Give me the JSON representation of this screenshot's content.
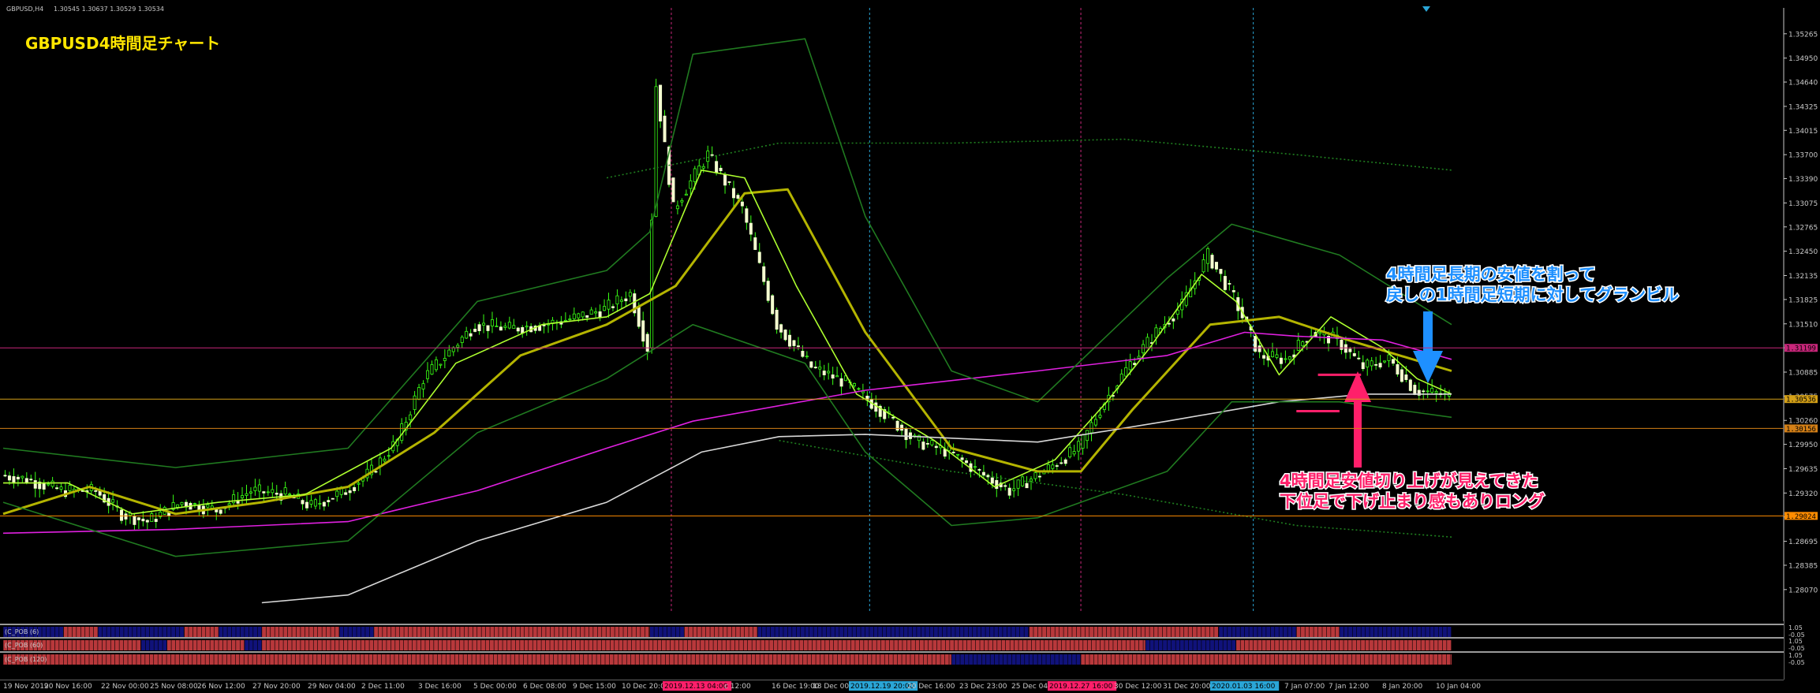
{
  "window": {
    "symbol": "GBPUSD,H4",
    "ohlc": "1.30545 1.30637 1.30529 1.30534",
    "title": "GBPUSD4時間足チャート"
  },
  "annotations": {
    "blue_line1": "4時間足長期の安値を割って",
    "blue_line2": "戻しの1時間足短期に対してグランビル",
    "pink_line1": "4時間足安値切り上げが見えてきた",
    "pink_line2": "下位足で下げ止まり感もありロング"
  },
  "levels": [
    {
      "value": 1.31199,
      "label": "1.31199",
      "color": "#c8267a"
    },
    {
      "value": 1.30536,
      "label": "1.30536",
      "color": "#d4a017"
    },
    {
      "value": 1.30156,
      "label": "1.30156",
      "color": "#d48017"
    },
    {
      "value": 1.29024,
      "label": "1.29024",
      "color": "#ff8c00"
    }
  ],
  "indicators": [
    {
      "name": "(C_POB (6)",
      "scale_top": "1.05",
      "scale_bot": "-0.05"
    },
    {
      "name": "(C_POB (60)",
      "scale_top": "1.05",
      "scale_bot": "-0.05"
    },
    {
      "name": "(C_POB (120)",
      "scale_top": "1.05",
      "scale_bot": "-0.05"
    }
  ],
  "chart_data": {
    "type": "candlestick",
    "title": "GBPUSD4時間足チャート",
    "symbol": "GBPUSD,H4",
    "ylim": [
      1.27762,
      1.356
    ],
    "y_ticks": [
      1.35265,
      1.3495,
      1.3464,
      1.34325,
      1.34015,
      1.337,
      1.3339,
      1.33075,
      1.32765,
      1.3245,
      1.32135,
      1.31825,
      1.3151,
      1.312,
      1.30885,
      1.30575,
      1.3026,
      1.2995,
      1.29635,
      1.2932,
      1.2901,
      1.28695,
      1.28385,
      1.2807
    ],
    "x_ticks": [
      "19 Nov 2019",
      "20 Nov 16:00",
      "22 Nov 00:00",
      "25 Nov 08:00",
      "26 Nov 12:00",
      "27 Nov 20:00",
      "29 Nov 04:00",
      "2 Dec 11:00",
      "3 Dec 16:00",
      "5 Dec 00:00",
      "6 Dec 08:00",
      "9 Dec 15:00",
      "10 Dec 20:00",
      "2019.12.13 04:00",
      "c 12:00",
      "16 Dec 19:00",
      "18 Dec 00:00",
      "2019.12.19 20:00",
      "20 Dec 16:00",
      "23 Dec 23:00",
      "25 Dec 04:00",
      "2019.12.27 16:00",
      "30 Dec 12:00",
      "31 Dec 20:00",
      "2020.01.03 16:00",
      "7 Jan 07:00",
      "7 Jan 12:00",
      "8 Jan 20:00",
      "10 Jan 04:00"
    ],
    "x_highlighted": [
      "2019.12.13 04:00",
      "2019.12.19 20:00",
      "2019.12.27 16:00",
      "2020.01.03 16:00"
    ],
    "anchors": [
      [
        0,
        1.2955
      ],
      [
        6,
        1.295
      ],
      [
        14,
        1.2935
      ],
      [
        22,
        1.2935
      ],
      [
        28,
        1.2905
      ],
      [
        34,
        1.2895
      ],
      [
        42,
        1.292
      ],
      [
        50,
        1.291
      ],
      [
        58,
        1.2935
      ],
      [
        66,
        1.293
      ],
      [
        72,
        1.2915
      ],
      [
        80,
        1.2935
      ],
      [
        86,
        1.296
      ],
      [
        92,
        1.3
      ],
      [
        98,
        1.308
      ],
      [
        104,
        1.3115
      ],
      [
        110,
        1.315
      ],
      [
        118,
        1.3145
      ],
      [
        126,
        1.315
      ],
      [
        134,
        1.316
      ],
      [
        140,
        1.317
      ],
      [
        146,
        1.319
      ],
      [
        150,
        1.312
      ],
      [
        152,
        1.346
      ],
      [
        156,
        1.33
      ],
      [
        164,
        1.337
      ],
      [
        172,
        1.33
      ],
      [
        180,
        1.315
      ],
      [
        188,
        1.3095
      ],
      [
        196,
        1.3075
      ],
      [
        204,
        1.304
      ],
      [
        212,
        1.3
      ],
      [
        220,
        1.2985
      ],
      [
        228,
        1.2955
      ],
      [
        234,
        1.2935
      ],
      [
        242,
        1.296
      ],
      [
        250,
        1.299
      ],
      [
        256,
        1.305
      ],
      [
        262,
        1.31
      ],
      [
        268,
        1.314
      ],
      [
        274,
        1.3175
      ],
      [
        280,
        1.324
      ],
      [
        286,
        1.3185
      ],
      [
        292,
        1.311
      ],
      [
        298,
        1.3105
      ],
      [
        304,
        1.314
      ],
      [
        310,
        1.313
      ],
      [
        316,
        1.3095
      ],
      [
        322,
        1.3105
      ],
      [
        328,
        1.3065
      ],
      [
        334,
        1.306
      ],
      [
        336,
        1.3055
      ]
    ],
    "series": [
      {
        "name": "",
        "type": "line",
        "color": "#b4b400",
        "points": [
          [
            0,
            1.2905
          ],
          [
            20,
            1.294
          ],
          [
            40,
            1.2905
          ],
          [
            60,
            1.292
          ],
          [
            80,
            1.294
          ],
          [
            100,
            1.301
          ],
          [
            120,
            1.311
          ],
          [
            140,
            1.315
          ],
          [
            156,
            1.32
          ],
          [
            172,
            1.332
          ],
          [
            182,
            1.3325
          ],
          [
            200,
            1.314
          ],
          [
            220,
            1.299
          ],
          [
            240,
            1.296
          ],
          [
            250,
            1.296
          ],
          [
            262,
            1.304
          ],
          [
            280,
            1.315
          ],
          [
            296,
            1.316
          ],
          [
            312,
            1.313
          ],
          [
            336,
            1.309
          ]
        ]
      },
      {
        "name": "",
        "type": "line",
        "color": "#adff2f",
        "points": [
          [
            0,
            1.2945
          ],
          [
            15,
            1.2945
          ],
          [
            30,
            1.2905
          ],
          [
            50,
            1.292
          ],
          [
            70,
            1.293
          ],
          [
            90,
            1.299
          ],
          [
            105,
            1.31
          ],
          [
            125,
            1.315
          ],
          [
            140,
            1.316
          ],
          [
            150,
            1.319
          ],
          [
            162,
            1.335
          ],
          [
            172,
            1.334
          ],
          [
            184,
            1.32
          ],
          [
            198,
            1.306
          ],
          [
            216,
            1.3
          ],
          [
            230,
            1.294
          ],
          [
            244,
            1.2975
          ],
          [
            256,
            1.305
          ],
          [
            266,
            1.312
          ],
          [
            278,
            1.3215
          ],
          [
            286,
            1.318
          ],
          [
            296,
            1.3085
          ],
          [
            308,
            1.316
          ],
          [
            320,
            1.312
          ],
          [
            328,
            1.308
          ],
          [
            336,
            1.306
          ]
        ]
      },
      {
        "name": "",
        "type": "line",
        "color": "#e020e0",
        "points": [
          [
            0,
            1.288
          ],
          [
            40,
            1.2885
          ],
          [
            80,
            1.2895
          ],
          [
            110,
            1.2935
          ],
          [
            140,
            1.299
          ],
          [
            160,
            1.3025
          ],
          [
            200,
            1.3065
          ],
          [
            240,
            1.309
          ],
          [
            270,
            1.311
          ],
          [
            288,
            1.314
          ],
          [
            300,
            1.3135
          ],
          [
            320,
            1.313
          ],
          [
            336,
            1.3105
          ]
        ]
      },
      {
        "name": "",
        "type": "line",
        "color": "#d8d8d8",
        "points": [
          [
            60,
            1.279
          ],
          [
            80,
            1.28
          ],
          [
            110,
            1.287
          ],
          [
            140,
            1.292
          ],
          [
            162,
            1.2985
          ],
          [
            180,
            1.3005
          ],
          [
            200,
            1.3008
          ],
          [
            240,
            1.2998
          ],
          [
            270,
            1.3025
          ],
          [
            296,
            1.305
          ],
          [
            316,
            1.306
          ],
          [
            336,
            1.306
          ]
        ]
      },
      {
        "name": "",
        "type": "line",
        "color": "#207a20",
        "points": [
          [
            0,
            1.299
          ],
          [
            40,
            1.2965
          ],
          [
            80,
            1.299
          ],
          [
            110,
            1.318
          ],
          [
            140,
            1.322
          ],
          [
            150,
            1.327
          ],
          [
            160,
            1.35
          ],
          [
            186,
            1.352
          ],
          [
            200,
            1.329
          ],
          [
            220,
            1.309
          ],
          [
            240,
            1.305
          ],
          [
            270,
            1.321
          ],
          [
            285,
            1.328
          ],
          [
            310,
            1.324
          ],
          [
            336,
            1.315
          ]
        ]
      },
      {
        "name": "",
        "type": "line",
        "color": "#207a20",
        "points": [
          [
            0,
            1.292
          ],
          [
            40,
            1.285
          ],
          [
            80,
            1.287
          ],
          [
            110,
            1.301
          ],
          [
            140,
            1.308
          ],
          [
            160,
            1.315
          ],
          [
            186,
            1.31
          ],
          [
            200,
            1.2985
          ],
          [
            220,
            1.289
          ],
          [
            240,
            1.29
          ],
          [
            270,
            1.296
          ],
          [
            285,
            1.305
          ],
          [
            310,
            1.305
          ],
          [
            336,
            1.303
          ]
        ]
      },
      {
        "name": "",
        "type": "line",
        "color": "#1f7f1f",
        "dashed": true,
        "points": [
          [
            140,
            1.334
          ],
          [
            180,
            1.3385
          ],
          [
            220,
            1.3385
          ],
          [
            260,
            1.339
          ],
          [
            300,
            1.337
          ],
          [
            336,
            1.335
          ]
        ]
      },
      {
        "name": "",
        "type": "line",
        "color": "#1f7f1f",
        "dashed": true,
        "points": [
          [
            180,
            1.3
          ],
          [
            220,
            1.296
          ],
          [
            260,
            1.293
          ],
          [
            300,
            1.289
          ],
          [
            336,
            1.2875
          ]
        ]
      }
    ],
    "vlines": [
      {
        "x_index": 155,
        "color": "#c8267a"
      },
      {
        "x_index": 201,
        "color": "#2aa5d6"
      },
      {
        "x_index": 250,
        "color": "#c8267a"
      },
      {
        "x_index": 290,
        "color": "#2aa5d6"
      }
    ],
    "hsegments": [
      {
        "x0": 300,
        "x1": 310,
        "y": 1.3038,
        "color": "#ff1f6a"
      },
      {
        "x0": 305,
        "x1": 315,
        "y": 1.3085,
        "color": "#ff1f6a"
      }
    ],
    "pob_rows": [
      {
        "name": "(C_POB (6)",
        "segments": [
          [
            0,
            14,
            "b"
          ],
          [
            14,
            22,
            "r"
          ],
          [
            22,
            42,
            "b"
          ],
          [
            42,
            50,
            "r"
          ],
          [
            50,
            60,
            "b"
          ],
          [
            60,
            78,
            "r"
          ],
          [
            78,
            86,
            "b"
          ],
          [
            86,
            150,
            "r"
          ],
          [
            150,
            158,
            "b"
          ],
          [
            158,
            175,
            "r"
          ],
          [
            175,
            238,
            "b"
          ],
          [
            238,
            282,
            "r"
          ],
          [
            282,
            300,
            "b"
          ],
          [
            300,
            310,
            "r"
          ],
          [
            310,
            336,
            "b"
          ]
        ]
      },
      {
        "name": "(C_POB (60)",
        "segments": [
          [
            0,
            32,
            "r"
          ],
          [
            32,
            38,
            "b"
          ],
          [
            38,
            56,
            "r"
          ],
          [
            56,
            60,
            "b"
          ],
          [
            60,
            265,
            "r"
          ],
          [
            265,
            286,
            "b"
          ],
          [
            286,
            336,
            "r"
          ]
        ]
      },
      {
        "name": "(C_POB (120)",
        "segments": [
          [
            0,
            220,
            "r"
          ],
          [
            220,
            250,
            "b"
          ],
          [
            250,
            336,
            "r"
          ]
        ]
      }
    ],
    "grid": false,
    "legend": "none"
  }
}
